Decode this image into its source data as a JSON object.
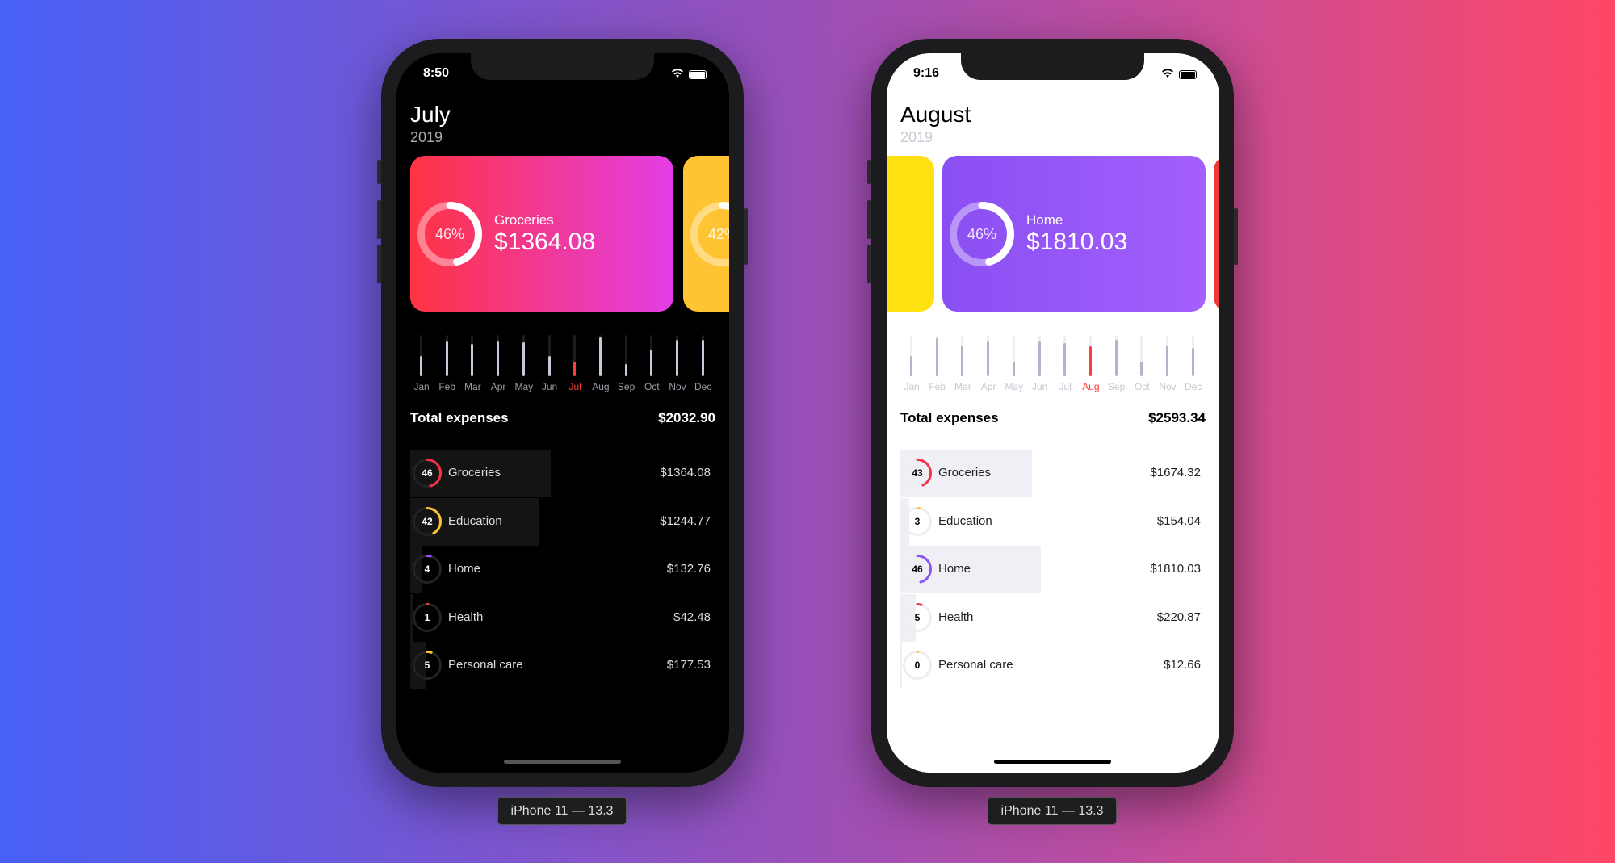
{
  "phones": [
    {
      "theme": "dark",
      "status_time": "8:50",
      "month": "July",
      "year": "2019",
      "cards": [
        {
          "role": "main",
          "name": "Groceries",
          "amount": "$1364.08",
          "percent_label": "46%",
          "percent": 46,
          "gradient": [
            "#ff3342",
            "#e33ee6"
          ]
        },
        {
          "role": "next",
          "percent_label": "42%",
          "percent": 42,
          "gradient": [
            "#ffc433",
            "#ffbf30"
          ]
        }
      ],
      "chart_data": {
        "type": "bar",
        "categories": [
          "Jan",
          "Feb",
          "Mar",
          "Apr",
          "May",
          "Jun",
          "Jul",
          "Aug",
          "Sep",
          "Oct",
          "Nov",
          "Dec"
        ],
        "values": [
          0.5,
          0.85,
          0.78,
          0.85,
          0.83,
          0.5,
          0.35,
          0.95,
          0.3,
          0.65,
          0.88,
          0.88
        ],
        "active": "Jul",
        "ylim": [
          0,
          1
        ]
      },
      "total_label": "Total expenses",
      "total": "$2032.90",
      "categories": [
        {
          "percent": "46",
          "name": "Groceries",
          "amount": "$1364.08",
          "color": "#f2334a"
        },
        {
          "percent": "42",
          "name": "Education",
          "amount": "$1244.77",
          "color": "#ffc433"
        },
        {
          "percent": "4",
          "name": "Home",
          "amount": "$132.76",
          "color": "#8a55f5"
        },
        {
          "percent": "1",
          "name": "Health",
          "amount": "$42.48",
          "color": "#f2334a"
        },
        {
          "percent": "5",
          "name": "Personal care",
          "amount": "$177.53",
          "color": "#ffc433"
        }
      ],
      "device_label": "iPhone 11 — 13.3"
    },
    {
      "theme": "light",
      "status_time": "9:16",
      "month": "August",
      "year": "2019",
      "cards": [
        {
          "role": "prev",
          "gradient": [
            "#ffe010",
            "#ffe010"
          ]
        },
        {
          "role": "main",
          "name": "Home",
          "amount": "$1810.03",
          "percent_label": "46%",
          "percent": 46,
          "gradient": [
            "#8a4ff2",
            "#a45ffd"
          ]
        },
        {
          "role": "next",
          "gradient": [
            "#f03a3a",
            "#f03a3a"
          ]
        }
      ],
      "chart_data": {
        "type": "bar",
        "categories": [
          "Jan",
          "Feb",
          "Mar",
          "Apr",
          "May",
          "Jun",
          "Jul",
          "Aug",
          "Sep",
          "Oct",
          "Nov",
          "Dec"
        ],
        "values": [
          0.5,
          0.92,
          0.75,
          0.85,
          0.35,
          0.85,
          0.8,
          0.72,
          0.88,
          0.35,
          0.75,
          0.68
        ],
        "active": "Aug",
        "ylim": [
          0,
          1
        ]
      },
      "total_label": "Total expenses",
      "total": "$2593.34",
      "categories": [
        {
          "percent": "43",
          "name": "Groceries",
          "amount": "$1674.32",
          "color": "#f2334a"
        },
        {
          "percent": "3",
          "name": "Education",
          "amount": "$154.04",
          "color": "#ffc433"
        },
        {
          "percent": "46",
          "name": "Home",
          "amount": "$1810.03",
          "color": "#8a55f5"
        },
        {
          "percent": "5",
          "name": "Health",
          "amount": "$220.87",
          "color": "#f2334a"
        },
        {
          "percent": "0",
          "name": "Personal care",
          "amount": "$12.66",
          "color": "#ffc433"
        }
      ],
      "device_label": "iPhone 11 — 13.3"
    }
  ],
  "colors": {
    "active_month": "#ff3b3b"
  }
}
